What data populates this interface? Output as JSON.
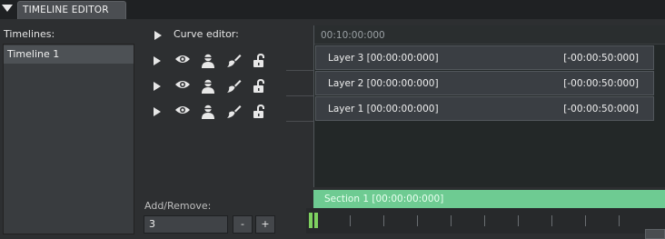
{
  "window": {
    "title": "TIMELINE EDITOR"
  },
  "sidebar": {
    "label": "Timelines:",
    "items": [
      {
        "label": "Timeline 1",
        "selected": true
      }
    ]
  },
  "tree": {
    "curve_editor_label": "Curve editor:",
    "rows": [
      {
        "icons": [
          "play-icon",
          "eye-icon",
          "user-icon",
          "brush-icon",
          "unlock-icon"
        ]
      },
      {
        "icons": [
          "play-icon",
          "eye-icon",
          "user-icon",
          "brush-icon",
          "unlock-icon"
        ]
      },
      {
        "icons": [
          "play-icon",
          "eye-icon",
          "user-icon",
          "brush-icon",
          "unlock-icon"
        ]
      }
    ]
  },
  "ruler": {
    "time": "00:10:00:000"
  },
  "layers": [
    {
      "name": "Layer 3 [00:00:00:000]",
      "duration": "[-00:00:50:000]"
    },
    {
      "name": "Layer 2 [00:00:00:000]",
      "duration": "[-00:00:50:000]"
    },
    {
      "name": "Layer 1 [00:00:00:000]",
      "duration": "[-00:00:50:000]"
    }
  ],
  "section": {
    "label": "Section 1 [00:00:00:000]",
    "color": "#6ecb92"
  },
  "add_remove": {
    "label": "Add/Remove:",
    "value": "3",
    "minus_label": "-",
    "plus_label": "+"
  },
  "colors": {
    "accent": "#6ecb92",
    "playhead": "#7ed160"
  }
}
